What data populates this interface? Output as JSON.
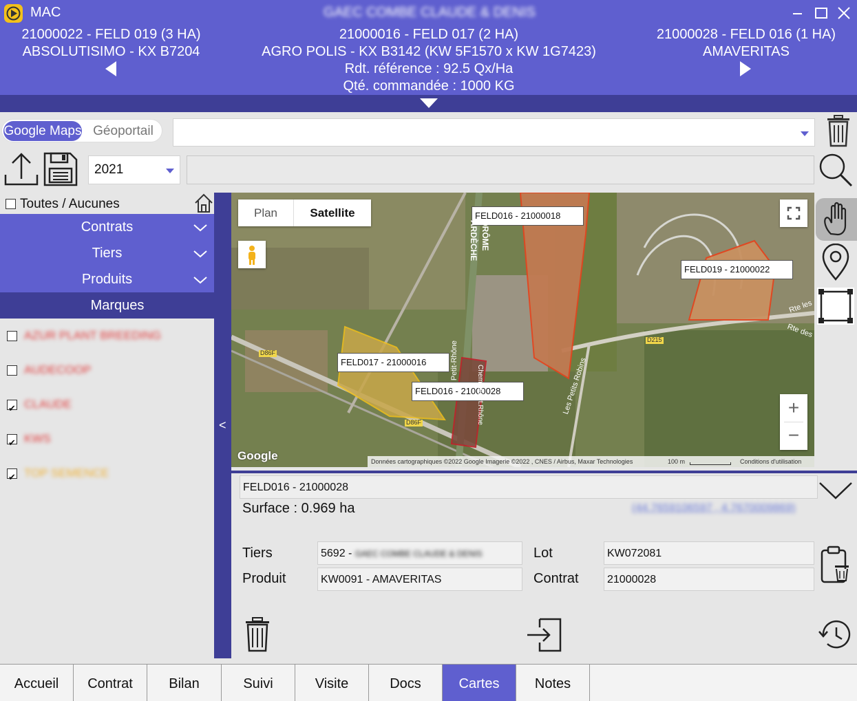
{
  "app": {
    "title": "MAC",
    "client_name": "GAEC COMBE CLAUDE & DENIS"
  },
  "header": {
    "left": {
      "line1": "21000022 - FELD 019 (3 HA)",
      "line2": "ABSOLUTISIMO - KX B7204"
    },
    "center": {
      "line1": "21000016 - FELD 017 (2 HA)",
      "line2": "AGRO POLIS - KX B3142 (KW 5F1570 x KW 1G7423)",
      "line3": "Rdt. référence : 92.5 Qx/Ha",
      "line4": "Qté. commandée : 1000 KG"
    },
    "right": {
      "line1": "21000028 - FELD 016 (1 HA)",
      "line2": "AMAVERITAS"
    }
  },
  "map_source": {
    "option1": "Google Maps",
    "option2": "Géoportail",
    "selected": "Google Maps"
  },
  "toolbar": {
    "year": "2021",
    "search_value": "",
    "address_value": ""
  },
  "sidebar": {
    "select_all_label": "Toutes / Aucunes",
    "sections": [
      {
        "label": "Contrats"
      },
      {
        "label": "Tiers"
      },
      {
        "label": "Produits"
      },
      {
        "label": "Marques"
      }
    ],
    "brands": [
      {
        "label": "AZUR PLANT BREEDING",
        "checked": false,
        "color": "#e23b3b"
      },
      {
        "label": "AUDECOOP",
        "checked": false,
        "color": "#e23b3b"
      },
      {
        "label": "CLAUDE",
        "checked": true,
        "color": "#e23b3b"
      },
      {
        "label": "KWS",
        "checked": true,
        "color": "#e23b3b"
      },
      {
        "label": "TOP SEMENCE",
        "checked": true,
        "color": "#f0b030"
      }
    ],
    "collapse_glyph": "<"
  },
  "map": {
    "type_plan": "Plan",
    "type_satellite": "Satellite",
    "selected_type": "Satellite",
    "parcels": [
      {
        "label": "FELD016 - 21000018"
      },
      {
        "label": "FELD019 - 21000022"
      },
      {
        "label": "FELD017 - 21000016"
      },
      {
        "label": "FELD016 - 21000028"
      }
    ],
    "road_labels": [
      "ARDÈCHE",
      "DRÔME",
      "D86F",
      "D86F",
      "D215",
      "Rte les",
      "Rte des",
      "Les Petits Robins",
      "Chem. du Pt.Rhône",
      "Petit-Rhône"
    ],
    "attribution": "Données cartographiques ©2022 Google Imagerie ©2022 , CNES / Airbus, Maxar Technologies",
    "scale": "100 m",
    "terms": "Conditions d'utilisation",
    "logo": "Google"
  },
  "detail": {
    "parcel_name": "FELD016 - 21000028",
    "surface": "Surface : 0.969 ha",
    "coords": "(44.7659106597 , 4.7670009869)",
    "tiers_label": "Tiers",
    "tiers_value": "5692 - ",
    "tiers_name": "GAEC COMBE CLAUDE & DENIS",
    "produit_label": "Produit",
    "produit_value": "KW0091 - AMAVERITAS",
    "lot_label": "Lot",
    "lot_value": "KW072081",
    "contrat_label": "Contrat",
    "contrat_value": "21000028"
  },
  "tabs": [
    {
      "label": "Accueil"
    },
    {
      "label": "Contrat"
    },
    {
      "label": "Bilan"
    },
    {
      "label": "Suivi"
    },
    {
      "label": "Visite"
    },
    {
      "label": "Docs"
    },
    {
      "label": "Cartes",
      "active": true
    },
    {
      "label": "Notes"
    }
  ],
  "colors": {
    "accent": "#5f5fcf",
    "accent_dark": "#3e3e96"
  }
}
